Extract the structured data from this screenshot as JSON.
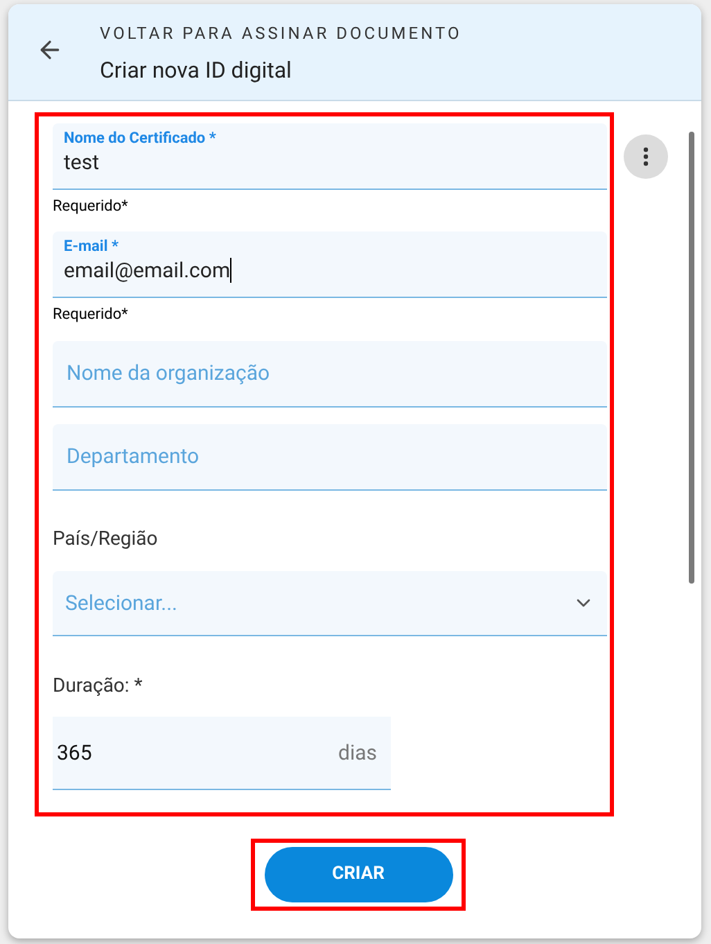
{
  "header": {
    "back_label": "VOLTAR PARA ASSINAR DOCUMENTO",
    "title": "Criar nova ID digital"
  },
  "fields": [
    {
      "kind": "filled",
      "label": "Nome do Certificado *",
      "value": "test",
      "helper": "Requerido*",
      "focused": false
    },
    {
      "kind": "filled",
      "label": "E-mail *",
      "value": "email@email.com",
      "helper": "Requerido*",
      "focused": true
    },
    {
      "kind": "empty",
      "placeholder": "Nome da organização",
      "focused": false
    },
    {
      "kind": "empty",
      "placeholder": "Departamento",
      "focused": false
    }
  ],
  "country": {
    "label": "País/Região",
    "placeholder": "Selecionar..."
  },
  "duration": {
    "label": "Duração: *",
    "value": "365",
    "unit": "dias"
  },
  "create_button": "CRIAR"
}
